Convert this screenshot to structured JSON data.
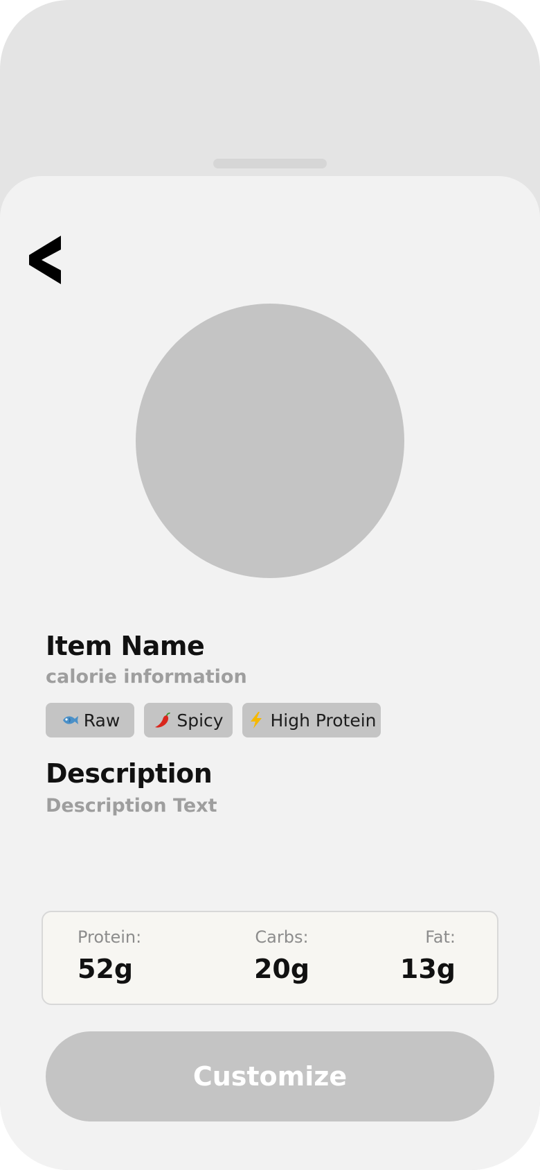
{
  "item": {
    "name": "Item Name",
    "calorie_info": "calorie information"
  },
  "tags": [
    {
      "icon": "fish-icon",
      "label": "Raw"
    },
    {
      "icon": "chili-pepper-icon",
      "label": "Spicy"
    },
    {
      "icon": "lightning-icon",
      "label": "High Protein"
    }
  ],
  "description": {
    "heading": "Description",
    "text": "Description Text"
  },
  "macros": {
    "protein": {
      "label": "Protein:",
      "value": "52g"
    },
    "carbs": {
      "label": "Carbs:",
      "value": "20g"
    },
    "fat": {
      "label": "Fat:",
      "value": "13g"
    }
  },
  "actions": {
    "customize_label": "Customize",
    "back_icon": "chevron-left-icon"
  },
  "colors": {
    "background": "#e4e4e4",
    "sheet": "#f2f2f2",
    "placeholder": "#c4c4c4",
    "muted_text": "#9e9e9e",
    "card_background": "#f7f6f2"
  }
}
